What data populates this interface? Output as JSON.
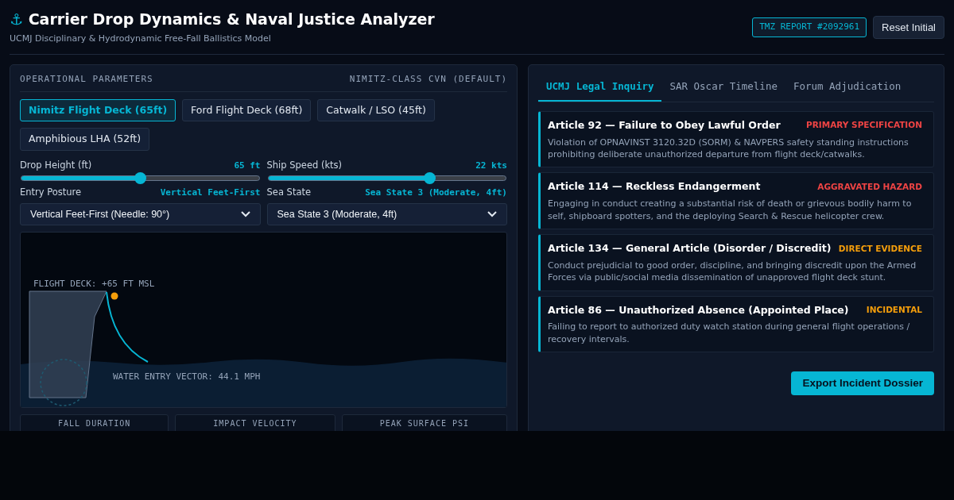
{
  "header": {
    "icon": "⚓",
    "title": "Carrier Drop Dynamics & Naval Justice Analyzer",
    "subtitle": "UCMJ Disciplinary & Hydrodynamic Free-Fall Ballistics Model",
    "report_badge": "TMZ REPORT #2092961",
    "reset_button": "Reset Initial"
  },
  "params": {
    "title": "OPERATIONAL PARAMETERS",
    "vessel": "NIMITZ-CLASS CVN (DEFAULT)",
    "presets": [
      {
        "label": "Nimitz Flight Deck (65ft)",
        "selected": true
      },
      {
        "label": "Ford Flight Deck (68ft)",
        "selected": false
      },
      {
        "label": "Catwalk / LSO (45ft)",
        "selected": false
      },
      {
        "label": "Amphibious LHA (52ft)",
        "selected": false
      }
    ],
    "sliders": [
      {
        "label": "Drop Height (ft)",
        "reading": "65 ft",
        "level": 0.5
      },
      {
        "label": "Ship Speed (kts)",
        "reading": "22 kts",
        "level": 0.68
      }
    ],
    "selects": [
      {
        "label": "Entry Posture",
        "reading": "Vertical Feet-First",
        "value": "Vertical Feet-First (Needle: 90°)"
      },
      {
        "label": "Sea State",
        "reading": "Sea State 3 (Moderate, 4ft)",
        "value": "Sea State 3 (Moderate, 4ft)"
      }
    ],
    "simulation": {
      "deck_label": "FLIGHT DECK: +65 FT MSL",
      "vector_label": "WATER ENTRY VECTOR: 44.1 MPH"
    },
    "stats": [
      {
        "label": "FALL DURATION"
      },
      {
        "label": "IMPACT VELOCITY"
      },
      {
        "label": "PEAK SURFACE PSI"
      }
    ]
  },
  "tabs": [
    {
      "label": "UCMJ Legal Inquiry",
      "selected": true
    },
    {
      "label": "SAR Oscar Timeline",
      "selected": false
    },
    {
      "label": "Forum Adjudication",
      "selected": false
    }
  ],
  "articles": [
    {
      "title": "Article 92 — Failure to Obey Lawful Order",
      "tag": "PRIMARY SPECIFICATION",
      "color": "#ef4444",
      "text": "Violation of OPNAVINST 3120.32D (SORM) & NAVPERS safety standing instructions prohibiting deliberate unauthorized departure from flight deck/catwalks."
    },
    {
      "title": "Article 114 — Reckless Endangerment",
      "tag": "AGGRAVATED HAZARD",
      "color": "#ef4444",
      "text": "Engaging in conduct creating a substantial risk of death or grievous bodily harm to self, shipboard spotters, and the deploying Search & Rescue helicopter crew."
    },
    {
      "title": "Article 134 — General Article (Disorder / Discredit)",
      "tag": "DIRECT EVIDENCE",
      "color": "#f59e0b",
      "text": "Conduct prejudicial to good order, discipline, and bringing discredit upon the Armed Forces via public/social media dissemination of unapproved flight deck stunt."
    },
    {
      "title": "Article 86 — Unauthorized Absence (Appointed Place)",
      "tag": "INCIDENTAL",
      "color": "#f59e0b",
      "text": "Failing to report to authorized duty watch station during general flight operations / recovery intervals."
    }
  ],
  "export_button": "Export Incident Dossier"
}
